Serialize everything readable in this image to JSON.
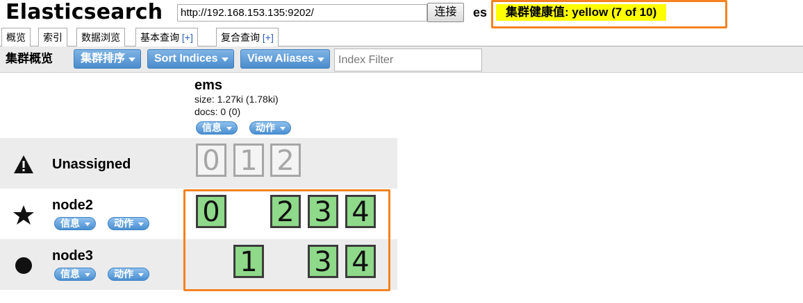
{
  "header": {
    "app_title": "Elasticsearch",
    "url": "http://192.168.153.135:9202/",
    "connect_label": "连接",
    "cluster_name": "es",
    "health_text": "集群健康值: yellow (7 of 10)",
    "health_color": "#ffff00"
  },
  "tabs": [
    {
      "label": "概览",
      "plus": ""
    },
    {
      "label": "索引",
      "plus": ""
    },
    {
      "label": "数据浏览",
      "plus": ""
    },
    {
      "label": "基本查询",
      "plus": "[+]"
    },
    {
      "label": "复合查询",
      "plus": "[+]"
    }
  ],
  "toolbar": {
    "title": "集群概览",
    "sort_cluster_label": "集群排序",
    "sort_indices_label": "Sort Indices",
    "view_aliases_label": "View Aliases",
    "filter_placeholder": "Index Filter"
  },
  "index": {
    "name": "ems",
    "size": "size: 1.27ki (1.78ki)",
    "docs": "docs: 0 (0)",
    "info_label": "信息",
    "action_label": "动作"
  },
  "rows": {
    "unassigned": {
      "name": "Unassigned",
      "icon": "warning-icon",
      "shards": [
        "0",
        "1",
        "2"
      ]
    },
    "node2": {
      "name": "node2",
      "icon": "star-icon",
      "info_label": "信息",
      "action_label": "动作",
      "shards": [
        "0",
        "2",
        "3",
        "4"
      ]
    },
    "node3": {
      "name": "node3",
      "icon": "circle-icon",
      "info_label": "信息",
      "action_label": "动作",
      "shards": [
        "1",
        "3",
        "4"
      ]
    }
  },
  "colors": {
    "accent_box": "#f58220",
    "shard_assigned": "#8fd98a",
    "button_blue": "#4b8ccc"
  }
}
